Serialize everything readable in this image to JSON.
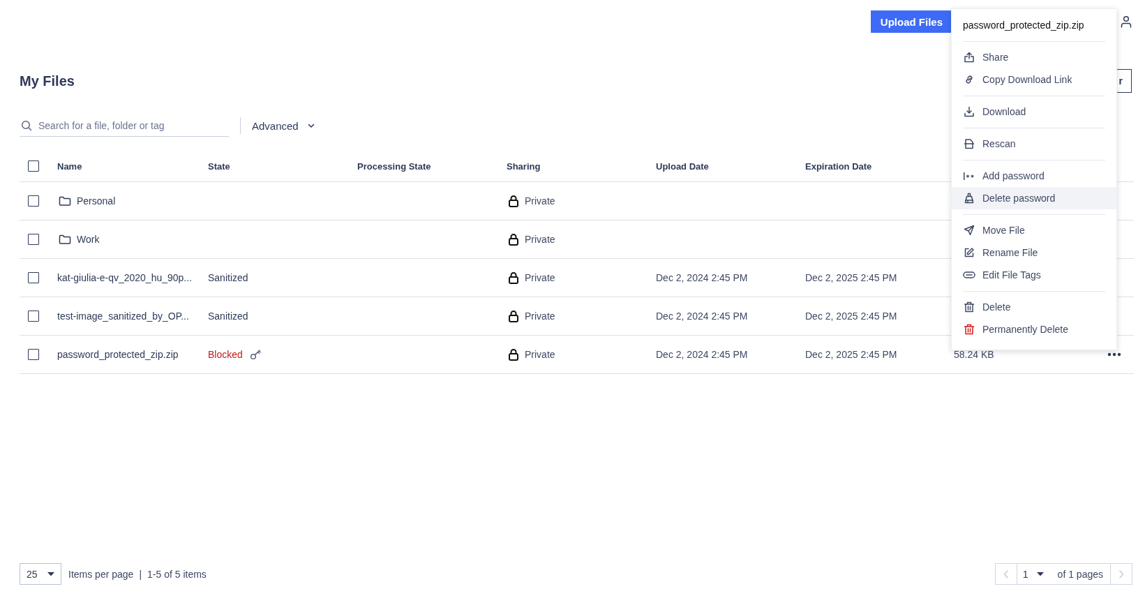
{
  "header": {
    "upload_button": "Upload Files"
  },
  "page": {
    "title": "My Files",
    "partial_button": "r"
  },
  "search": {
    "placeholder": "Search for a file, folder or tag"
  },
  "advanced_filter": {
    "label": "Advanced"
  },
  "table": {
    "all_checked": false,
    "columns": [
      "Name",
      "State",
      "Processing State",
      "Sharing",
      "Upload Date",
      "Expiration Date"
    ],
    "rows": [
      {
        "kind": "folder",
        "checked": false,
        "name": "Personal",
        "sharing": "Private"
      },
      {
        "kind": "folder",
        "checked": false,
        "name": "Work",
        "sharing": "Private"
      },
      {
        "kind": "file",
        "checked": false,
        "name": "kat-giulia-e-qv_2020_hu_90p...",
        "state": "Sanitized",
        "blocked": false,
        "password_protected": false,
        "sharing": "Private",
        "upload_date": "Dec 2, 2024 2:45 PM",
        "expiration_date": "Dec 2, 2025 2:45 PM"
      },
      {
        "kind": "file",
        "checked": false,
        "name": "test-image_sanitized_by_OP...",
        "state": "Sanitized",
        "blocked": false,
        "password_protected": false,
        "sharing": "Private",
        "upload_date": "Dec 2, 2024 2:45 PM",
        "expiration_date": "Dec 2, 2025 2:45 PM"
      },
      {
        "kind": "file",
        "checked": false,
        "name": "password_protected_zip.zip",
        "state": "Blocked",
        "blocked": true,
        "password_protected": true,
        "sharing": "Private",
        "upload_date": "Dec 2, 2024 2:45 PM",
        "expiration_date": "Dec 2, 2025 2:45 PM",
        "size": "58.24 KB",
        "more_actions": true
      }
    ]
  },
  "context_menu": {
    "title": "password_protected_zip.zip",
    "groups": [
      [
        {
          "label": "Share",
          "highlighted": false,
          "danger": false
        },
        {
          "label": "Copy Download Link",
          "highlighted": false,
          "danger": false
        }
      ],
      [
        {
          "label": "Download",
          "highlighted": false,
          "danger": false
        }
      ],
      [
        {
          "label": "Rescan",
          "highlighted": false,
          "danger": false
        }
      ],
      [
        {
          "label": "Add password",
          "highlighted": false,
          "danger": false
        },
        {
          "label": "Delete password",
          "highlighted": true,
          "danger": false
        }
      ],
      [
        {
          "label": "Move File",
          "highlighted": false,
          "danger": false
        },
        {
          "label": "Rename File",
          "highlighted": false,
          "danger": false
        },
        {
          "label": "Edit File Tags",
          "highlighted": false,
          "danger": false
        }
      ],
      [
        {
          "label": "Delete",
          "highlighted": false,
          "danger": false
        },
        {
          "label": "Permanently Delete",
          "highlighted": false,
          "danger": true
        }
      ]
    ]
  },
  "footer": {
    "per_page": "25",
    "per_page_label": "Items per page",
    "separator": "|",
    "range": "1-5 of 5 items",
    "page": "1",
    "page_total": "of 1 pages",
    "prev_disabled": true,
    "next_disabled": true
  }
}
